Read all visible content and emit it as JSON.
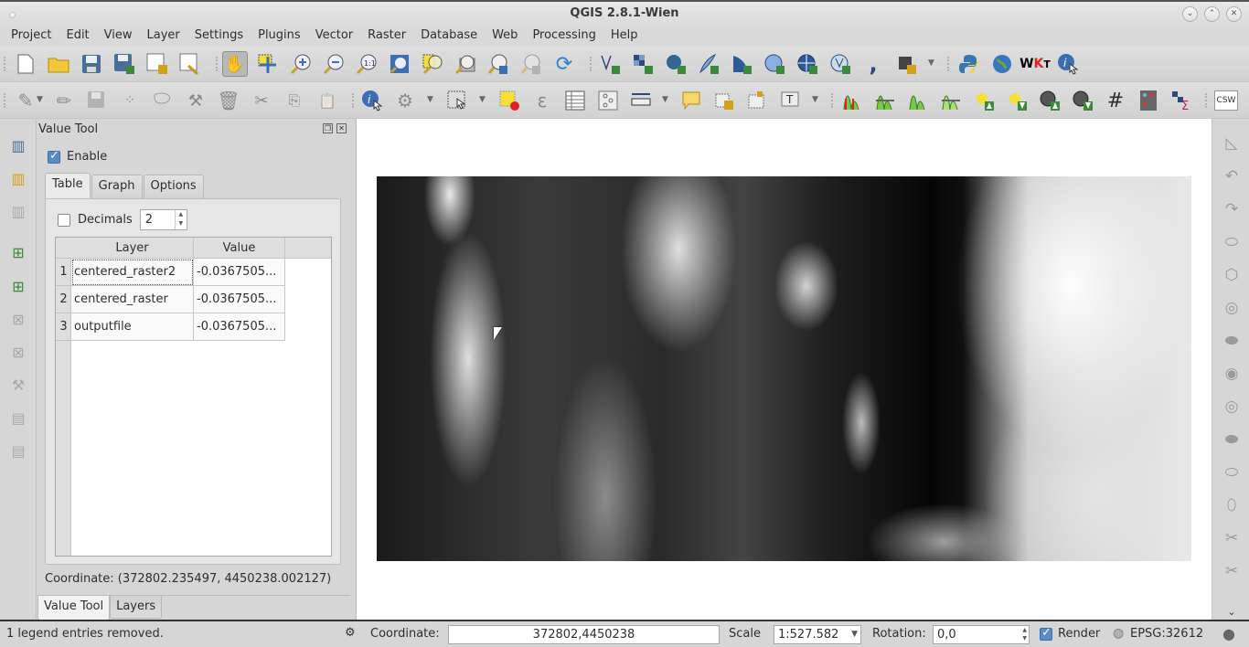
{
  "window": {
    "title": "QGIS 2.8.1-Wien",
    "controls": [
      "minimize",
      "maximize",
      "close"
    ]
  },
  "menu": [
    "Project",
    "Edit",
    "View",
    "Layer",
    "Settings",
    "Plugins",
    "Vector",
    "Raster",
    "Database",
    "Web",
    "Processing",
    "Help"
  ],
  "toolbar1": {
    "icons": [
      "new-project",
      "open-project",
      "save-project",
      "save-as",
      "new-print-composer",
      "composer-manager",
      "pan-map",
      "pan-to-selection",
      "zoom-in",
      "zoom-out",
      "zoom-native",
      "zoom-full",
      "zoom-to-selection",
      "zoom-to-layer",
      "zoom-last",
      "zoom-next",
      "refresh",
      "new-shapefile-layer",
      "add-raster-layer",
      "add-postgis-layer",
      "add-spatialite-layer",
      "add-mssql-layer",
      "add-wms-layer",
      "add-wcs-layer",
      "add-wfs-layer",
      "add-delimited-text-layer",
      "processing-toolbox",
      "python-console",
      "openlayers-plugin",
      "quick-wkt",
      "identify-plugin"
    ]
  },
  "toolbar2": {
    "icons": [
      "current-edits",
      "toggle-editing",
      "save-layer-edits",
      "add-feature",
      "move-feature",
      "node-tool",
      "delete-selected",
      "cut-features",
      "copy-features",
      "paste-features",
      "identify-features",
      "run-feature-action",
      "select-features",
      "deselect-all",
      "field-calculator",
      "open-attribute-table",
      "statistical-summary",
      "measure-line",
      "map-tips",
      "new-bookmark",
      "show-bookmarks",
      "text-annotation",
      "local-histogram-stretch",
      "full-histogram-stretch",
      "local-cumulative-cut",
      "full-cumulative-cut",
      "increase-brightness",
      "decrease-brightness",
      "increase-contrast",
      "decrease-contrast",
      "graticule",
      "raster-calculator",
      "zonal-statistics",
      "csw"
    ]
  },
  "value_tool": {
    "title": "Value Tool",
    "enable_label": "Enable",
    "enabled": true,
    "tabs": [
      "Table",
      "Graph",
      "Options"
    ],
    "active_tab": "Table",
    "decimals_label": "Decimals",
    "decimals_checked": false,
    "decimals_value": "2",
    "table": {
      "columns": [
        "Layer",
        "Value"
      ],
      "rows": [
        {
          "n": "1",
          "layer": "centered_raster2",
          "value": "-0.0367505..."
        },
        {
          "n": "2",
          "layer": "centered_raster",
          "value": "-0.0367505..."
        },
        {
          "n": "3",
          "layer": "outputfile",
          "value": "-0.0367505..."
        }
      ]
    },
    "coordinate": "Coordinate: (372802.235497, 4450238.002127)"
  },
  "dock_tabs": [
    "Value Tool",
    "Layers"
  ],
  "active_dock_tab": "Value Tool",
  "statusbar": {
    "message": "1 legend entries removed.",
    "coordinate_label": "Coordinate:",
    "coordinate_value": "372802,4450238",
    "scale_label": "Scale",
    "scale_value": "1:527.582",
    "rotation_label": "Rotation:",
    "rotation_value": "0,0",
    "render_label": "Render",
    "render_checked": true,
    "crs": "EPSG:32612"
  }
}
